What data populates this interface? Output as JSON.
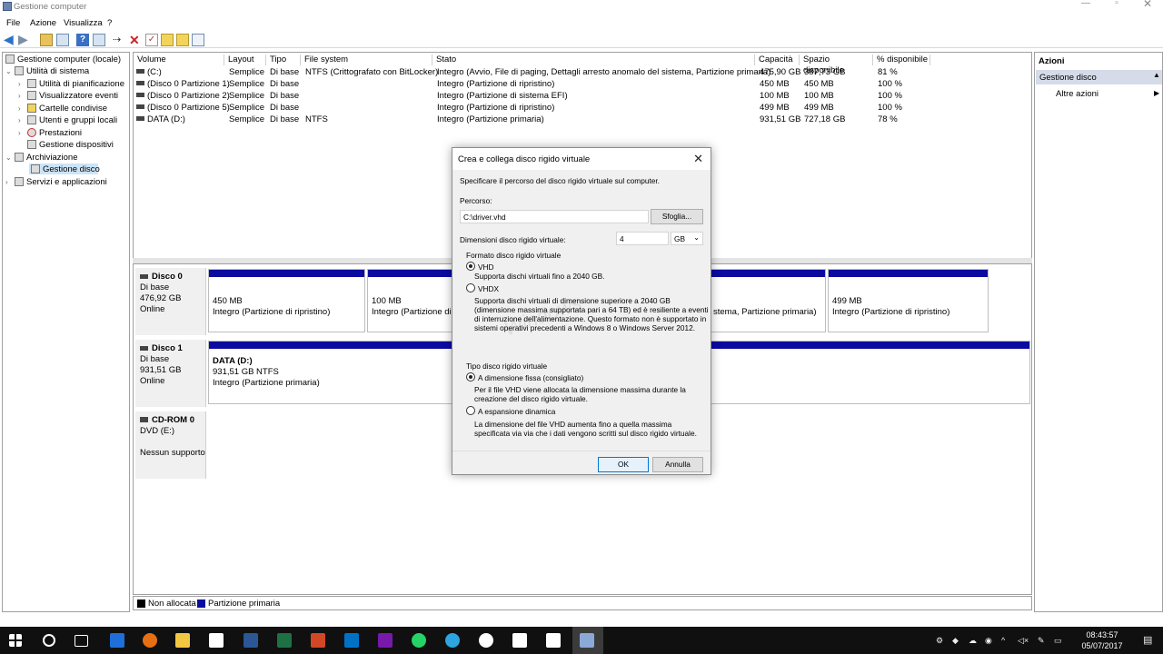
{
  "window": {
    "title": "Gestione computer"
  },
  "menu": [
    "File",
    "Azione",
    "Visualizza",
    "?"
  ],
  "tree": {
    "root": "Gestione computer (locale)",
    "system_tools": "Utilità di sistema",
    "items": [
      "Utilità di pianificazione",
      "Visualizzatore eventi",
      "Cartelle condivise",
      "Utenti e gruppi locali",
      "Prestazioni",
      "Gestione dispositivi"
    ],
    "storage": "Archiviazione",
    "disk_mgmt": "Gestione disco",
    "services": "Servizi e applicazioni"
  },
  "volumes": {
    "headers": [
      "Volume",
      "Layout",
      "Tipo",
      "File system",
      "Stato",
      "Capacità",
      "Spazio disponibile",
      "% disponibile"
    ],
    "rows": [
      [
        "(C:)",
        "Semplice",
        "Di base",
        "NTFS (Crittografato con BitLocker)",
        "Integro (Avvio, File di paging, Dettagli arresto anomalo del sistema, Partizione primaria)",
        "475,90 GB",
        "387,73 GB",
        "81 %"
      ],
      [
        "(Disco 0 Partizione 1)",
        "Semplice",
        "Di base",
        "",
        "Integro (Partizione di ripristino)",
        "450 MB",
        "450 MB",
        "100 %"
      ],
      [
        "(Disco 0 Partizione 2)",
        "Semplice",
        "Di base",
        "",
        "Integro (Partizione di sistema EFI)",
        "100 MB",
        "100 MB",
        "100 %"
      ],
      [
        "(Disco 0 Partizione 5)",
        "Semplice",
        "Di base",
        "",
        "Integro (Partizione di ripristino)",
        "499 MB",
        "499 MB",
        "100 %"
      ],
      [
        "DATA (D:)",
        "Semplice",
        "Di base",
        "NTFS",
        "Integro (Partizione primaria)",
        "931,51 GB",
        "727,18 GB",
        "78 %"
      ]
    ]
  },
  "disks": {
    "d0": {
      "name": "Disco 0",
      "type": "Di base",
      "size": "476,92 GB",
      "status": "Online"
    },
    "d0_parts": [
      {
        "size": "450 MB",
        "status": "Integro (Partizione di ripristino)"
      },
      {
        "size": "100 MB",
        "status": "Integro (Partizione di s"
      },
      {
        "size": "",
        "status": "stema, Partizione primaria)"
      },
      {
        "size": "499 MB",
        "status": "Integro (Partizione di ripristino)"
      }
    ],
    "d1": {
      "name": "Disco 1",
      "type": "Di base",
      "size": "931,51 GB",
      "status": "Online"
    },
    "d1_part": {
      "label": "DATA  (D:)",
      "size": "931,51 GB NTFS",
      "status": "Integro (Partizione primaria)"
    },
    "cd": {
      "name": "CD-ROM 0",
      "type": "DVD (E:)",
      "status": "Nessun supporto"
    }
  },
  "legend": {
    "unallocated": "Non allocata",
    "primary": "Partizione primaria"
  },
  "actions": {
    "title": "Azioni",
    "section": "Gestione disco",
    "more": "Altre azioni"
  },
  "dialog": {
    "title": "Crea e collega disco rigido virtuale",
    "intro": "Specificare il percorso del disco rigido virtuale sul computer.",
    "path_label": "Percorso:",
    "path_value": "C:\\driver.vhd",
    "browse": "Sfoglia...",
    "size_label": "Dimensioni disco rigido virtuale:",
    "size_value": "4",
    "unit": "GB",
    "format_label": "Formato disco rigido virtuale",
    "vhd": "VHD",
    "vhd_desc": "Supporta dischi virtuali fino a 2040 GB.",
    "vhdx": "VHDX",
    "vhdx_desc": [
      "Supporta dischi virtuali di dimensione superiore a 2040 GB",
      "(dimensione massima supportata pari a 64 TB) ed è resiliente a eventi",
      "di interruzione dell'alimentazione. Questo formato non è supportato in",
      "sistemi operativi precedenti a Windows 8 o Windows Server 2012."
    ],
    "type_label": "Tipo disco rigido virtuale",
    "fixed": "A dimensione fissa (consigliato)",
    "fixed_desc": [
      "Per il file VHD viene allocata la dimensione massima durante la",
      "creazione del disco rigido virtuale."
    ],
    "dynamic": "A espansione dinamica",
    "dynamic_desc": [
      "La dimensione del file VHD aumenta fino a quella massima",
      "specificata via via che i dati vengono scritti sul disco rigido virtuale."
    ],
    "ok": "OK",
    "cancel": "Annulla"
  },
  "clock": {
    "time": "08:43:57",
    "date": "05/07/2017"
  }
}
